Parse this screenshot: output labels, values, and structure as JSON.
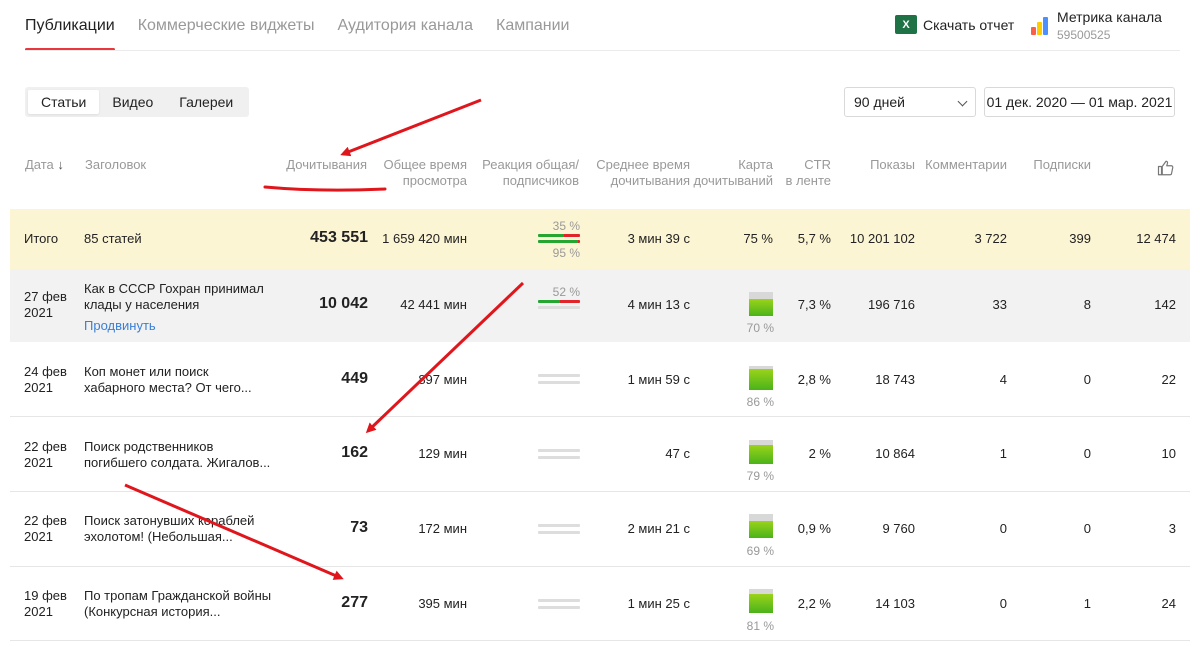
{
  "tabs": [
    {
      "label": "Публикации"
    },
    {
      "label": "Коммерческие виджеты"
    },
    {
      "label": "Аудитория канала"
    },
    {
      "label": "Кампании"
    }
  ],
  "report": {
    "label": "Скачать отчет",
    "icon": "excel-icon"
  },
  "metrika": {
    "label": "Метрика канала",
    "id": "59500525"
  },
  "segment": [
    {
      "label": "Статьи"
    },
    {
      "label": "Видео"
    },
    {
      "label": "Галереи"
    }
  ],
  "period": {
    "value": "90 дней"
  },
  "daterange": {
    "value": "01 дек. 2020 — 01 мар. 2021"
  },
  "headers": {
    "date": "Дата",
    "title": "Заголовок",
    "reads": "Дочитывания",
    "time1": "Общее время",
    "time2": "просмотра",
    "react1": "Реакция общая/",
    "react2": "подписчиков",
    "avg1": "Среднее время",
    "avg2": "дочитывания",
    "map1": "Карта",
    "map2": "дочитываний",
    "ctr1": "CTR",
    "ctr2": "в ленте",
    "shows": "Показы",
    "comments": "Комментарии",
    "subs": "Подписки"
  },
  "total": {
    "label": "Итого",
    "title": "85 статей",
    "reads": "453 551",
    "time": "1 659 420 мин",
    "react_top": "35 %",
    "react_bottom": "95 %",
    "avg": "3 мин 39 с",
    "map": "75 %",
    "ctr": "5,7 %",
    "shows": "10 201 102",
    "comments": "3 722",
    "subs": "399",
    "likes": "12 474"
  },
  "rows": [
    {
      "date1": "27 фев",
      "date2": "2021",
      "t1": "Как в СССР Гохран принимал",
      "t2": "клады у населения",
      "promote": "Продвинуть",
      "reads": "10 042",
      "time": "42 441 мин",
      "react": "52 %",
      "avg": "4 мин 13 с",
      "map": "70 %",
      "map_fill": 0.7,
      "ctr": "7,3 %",
      "shows": "196 716",
      "comments": "33",
      "subs": "8",
      "likes": "142"
    },
    {
      "date1": "24 фев",
      "date2": "2021",
      "t1": "Коп монет или поиск",
      "t2": "хабарного места? От чего...",
      "reads": "449",
      "time": "897 мин",
      "avg": "1 мин 59 с",
      "map": "86 %",
      "map_fill": 0.86,
      "ctr": "2,8 %",
      "shows": "18 743",
      "comments": "4",
      "subs": "0",
      "likes": "22"
    },
    {
      "date1": "22 фев",
      "date2": "2021",
      "t1": "Поиск родственников",
      "t2": "погибшего солдата. Жигалов...",
      "reads": "162",
      "time": "129 мин",
      "avg": "47 с",
      "map": "79 %",
      "map_fill": 0.79,
      "ctr": "2 %",
      "shows": "10 864",
      "comments": "1",
      "subs": "0",
      "likes": "10"
    },
    {
      "date1": "22 фев",
      "date2": "2021",
      "t1": "Поиск затонувших кораблей",
      "t2": "эхолотом! (Небольшая...",
      "reads": "73",
      "time": "172 мин",
      "avg": "2 мин 21 с",
      "map": "69 %",
      "map_fill": 0.69,
      "ctr": "0,9 %",
      "shows": "9 760",
      "comments": "0",
      "subs": "0",
      "likes": "3"
    },
    {
      "date1": "19 фев",
      "date2": "2021",
      "t1": "По тропам Гражданской войны",
      "t2": "(Конкурсная история...",
      "reads": "277",
      "time": "395 мин",
      "avg": "1 мин 25 с",
      "map": "81 %",
      "map_fill": 0.81,
      "ctr": "2,2 %",
      "shows": "14 103",
      "comments": "0",
      "subs": "1",
      "likes": "24"
    }
  ],
  "colors": {
    "accent": "#e8383d",
    "link": "#3a7fd6",
    "arrow": "#e0161d",
    "total_bg": "#fcf5d4"
  }
}
